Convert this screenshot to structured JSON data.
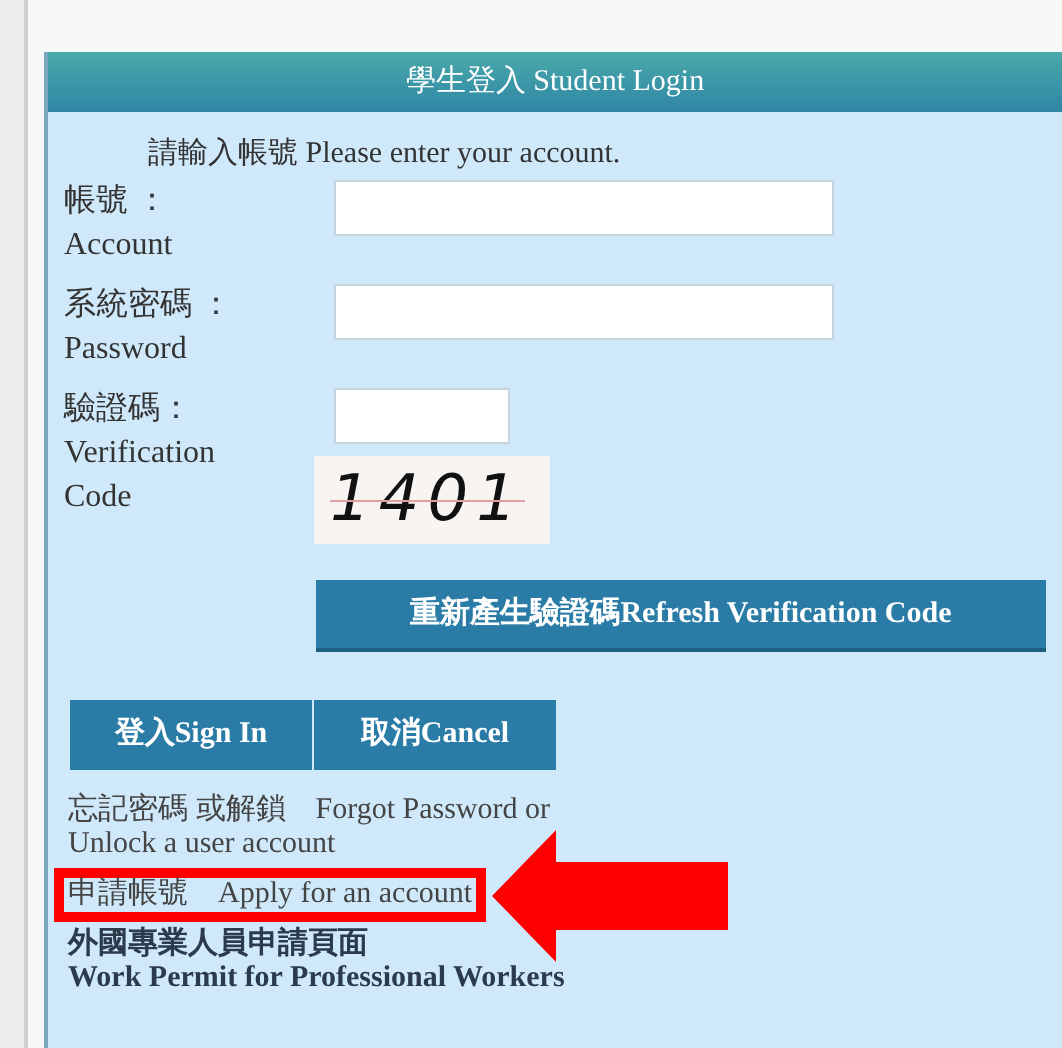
{
  "panel": {
    "title": "學生登入 Student Login",
    "prompt": "請輸入帳號 Please enter your account."
  },
  "fields": [
    {
      "label_zh": "帳號 ：",
      "label_en": "Account",
      "kind": "wide"
    },
    {
      "label_zh": "系統密碼 ：",
      "label_en": "Password",
      "kind": "wide"
    },
    {
      "label_zh": "驗證碼：",
      "label_en": "Verification Code",
      "kind": "captcha",
      "captcha": "1401"
    }
  ],
  "refresh_button": "重新產生驗證碼Refresh Verification Code",
  "buttons": [
    "登入Sign In",
    "取消Cancel"
  ],
  "links": [
    {
      "kind": "plain",
      "zh": "忘記密碼 或解鎖",
      "en": "Forgot Password or Unlock a user account",
      "highlighted": false
    },
    {
      "kind": "plain",
      "zh": "申請帳號",
      "en": "Apply for an account",
      "highlighted": true
    },
    {
      "kind": "bold",
      "zh": "外國專業人員申請頁面",
      "en": "Work Permit for Professional Workers",
      "highlighted": false
    }
  ]
}
